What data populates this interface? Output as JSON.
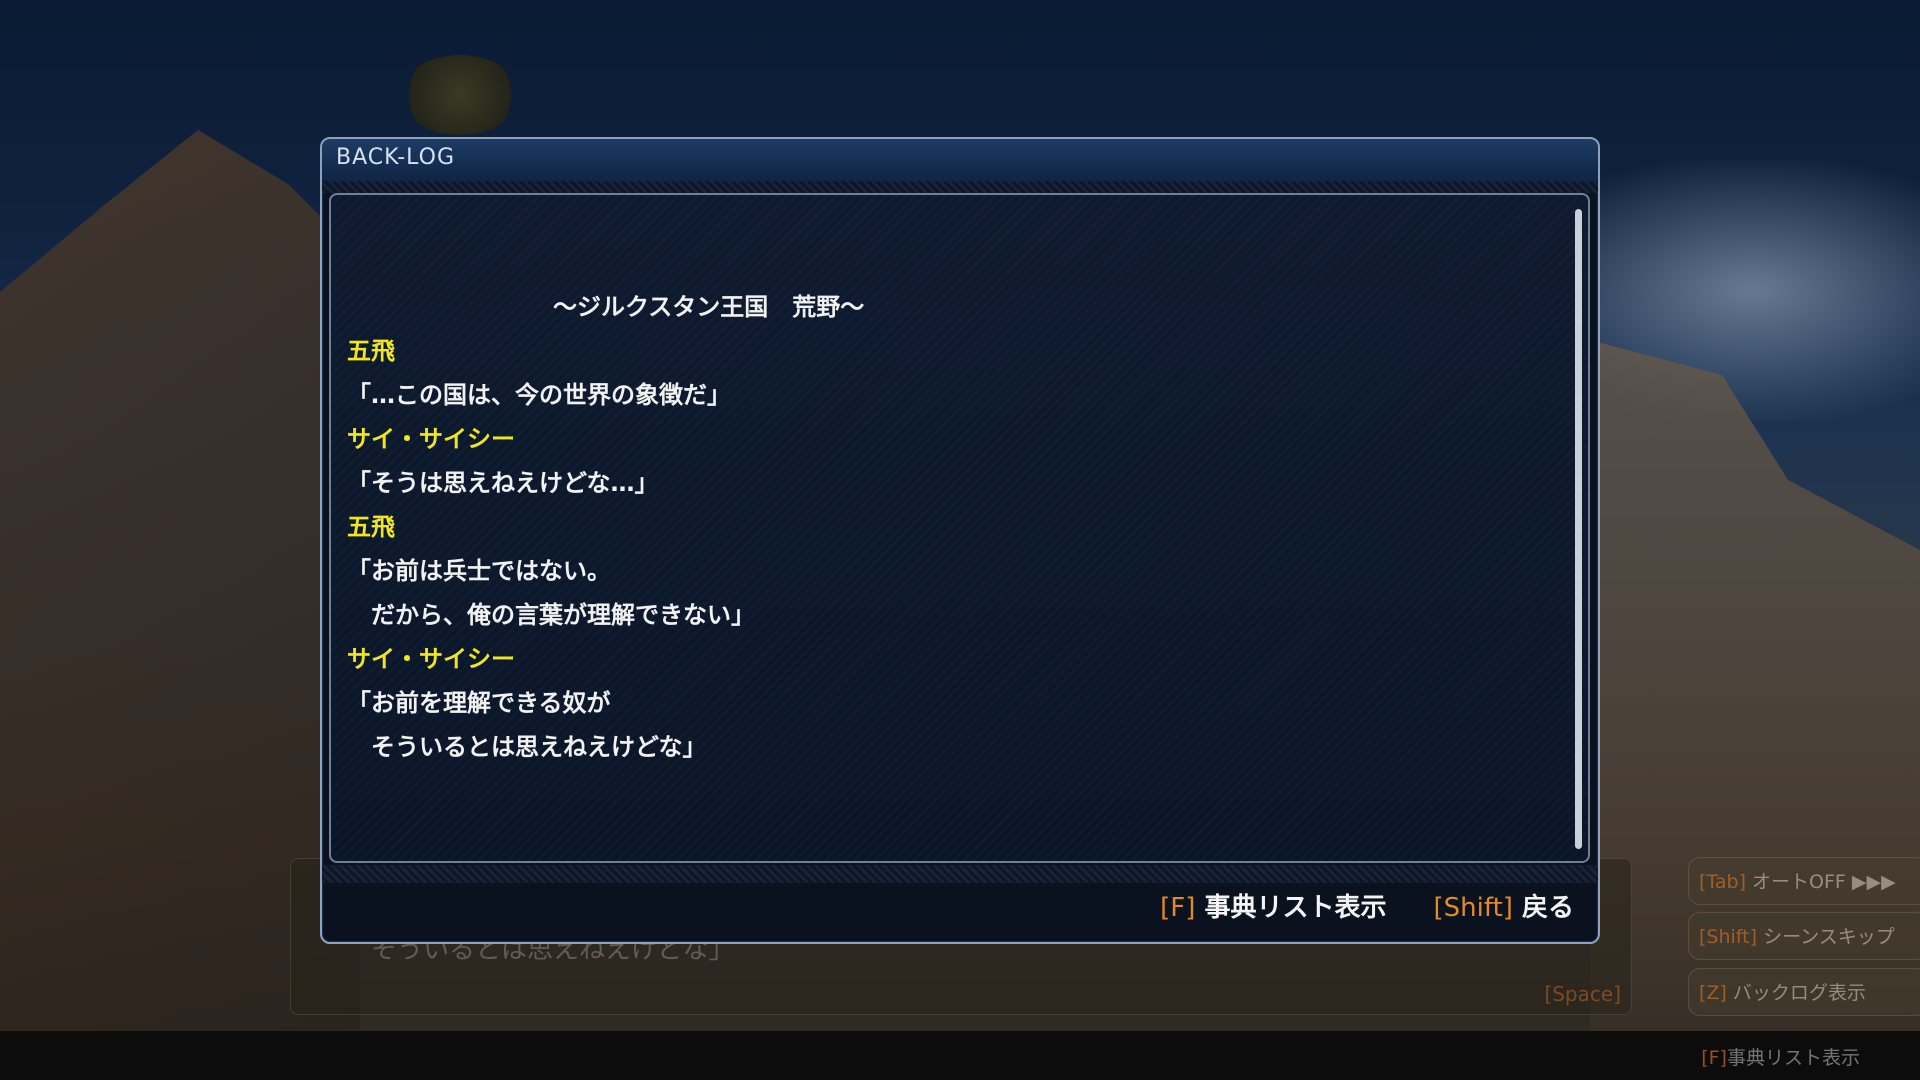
{
  "backlog": {
    "title": "BACK-LOG",
    "location": "～ジルクスタン王国　荒野～",
    "entries": [
      {
        "speaker": "五飛",
        "lines": [
          "「…この国は、今の世界の象徴だ」"
        ]
      },
      {
        "speaker": "サイ・サイシー",
        "lines": [
          "「そうは思えねえけどな…」"
        ]
      },
      {
        "speaker": "五飛",
        "lines": [
          "「お前は兵士ではない。",
          "　だから、俺の言葉が理解できない」"
        ]
      },
      {
        "speaker": "サイ・サイシー",
        "lines": [
          "「お前を理解できる奴が",
          "　そういるとは思えねえけどな」"
        ]
      }
    ],
    "controls": [
      {
        "key": "[F]",
        "label": "事典リスト表示"
      },
      {
        "key": "[Shift]",
        "label": "戻る"
      }
    ]
  },
  "background_ui": {
    "dialog_line": "そういるとは思えねえけどな」",
    "space_hint": "[Space]",
    "side_buttons": [
      {
        "key": "[Tab]",
        "label": "オートOFF ▶▶▶"
      },
      {
        "key": "[Shift]",
        "label": "シーンスキップ"
      },
      {
        "key": "[Z]",
        "label": "バックログ表示"
      }
    ],
    "footer_hint": {
      "key": "[F]",
      "label": "事典リスト表示"
    }
  },
  "colors": {
    "speaker": "#f2e61d",
    "key_accent": "#e68a1f",
    "header": "#1e3c66"
  }
}
